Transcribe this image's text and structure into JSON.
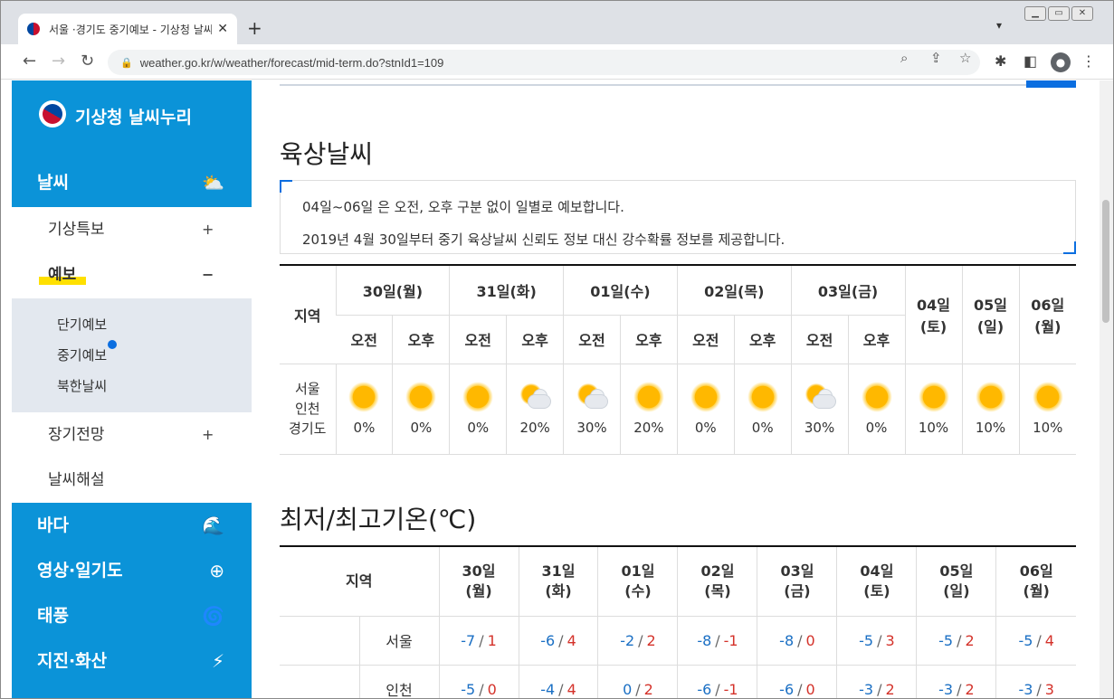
{
  "browser": {
    "tab_title": "서울 ·경기도 중기예보 - 기상청 날씨누리",
    "tab_close": "✕",
    "new_tab": "+",
    "url": "weather.go.kr/w/weather/forecast/mid-term.do?stnId1=109"
  },
  "sidebar": {
    "brand": "기상청 날씨누리",
    "categories": [
      {
        "label": "날씨",
        "icon": "weather-cloud-sun-icon"
      },
      {
        "label": "바다",
        "icon": "wave-icon"
      },
      {
        "label": "영상·일기도",
        "icon": "radar-target-icon"
      },
      {
        "label": "태풍",
        "icon": "typhoon-icon"
      },
      {
        "label": "지진·화산",
        "icon": "earthquake-icon"
      }
    ],
    "menu": [
      {
        "label": "기상특보",
        "toggle": "+"
      },
      {
        "label": "예보",
        "toggle": "−"
      },
      {
        "label": "장기전망",
        "toggle": "+"
      },
      {
        "label": "날씨해설"
      }
    ],
    "submenu": [
      "단기예보",
      "중기예보",
      "북한날씨"
    ]
  },
  "land": {
    "title": "육상날씨",
    "notice": [
      "04일~06일 은 오전, 오후 구분 없이 일별로 예보합니다.",
      "2019년 4월 30일부터 중기 육상날씨 신뢰도 정보 대신 강수확률 정보를 제공합니다."
    ],
    "region_header": "지역",
    "days_ampm": [
      "30일(월)",
      "31일(화)",
      "01일(수)",
      "02일(목)",
      "03일(금)"
    ],
    "days_daily": [
      [
        "04일",
        "(토)"
      ],
      [
        "05일",
        "(일)"
      ],
      [
        "06일",
        "(월)"
      ]
    ],
    "am": "오전",
    "pm": "오후",
    "region": [
      "서울",
      "인천",
      "경기도"
    ],
    "forecast": [
      {
        "icon": "sunny-icon",
        "prob": "0%"
      },
      {
        "icon": "sunny-icon",
        "prob": "0%"
      },
      {
        "icon": "sunny-icon",
        "prob": "0%"
      },
      {
        "icon": "partly-cloudy-icon",
        "prob": "20%"
      },
      {
        "icon": "partly-cloudy-icon",
        "prob": "30%"
      },
      {
        "icon": "sunny-icon",
        "prob": "20%"
      },
      {
        "icon": "sunny-icon",
        "prob": "0%"
      },
      {
        "icon": "sunny-icon",
        "prob": "0%"
      },
      {
        "icon": "partly-cloudy-icon",
        "prob": "30%"
      },
      {
        "icon": "sunny-icon",
        "prob": "0%"
      },
      {
        "icon": "sunny-icon",
        "prob": "10%"
      },
      {
        "icon": "sunny-icon",
        "prob": "10%"
      },
      {
        "icon": "sunny-icon",
        "prob": "10%"
      }
    ]
  },
  "temperature": {
    "title": "최저/최고기온(℃)",
    "region_header": "지역",
    "days": [
      [
        "30일",
        "(월)"
      ],
      [
        "31일",
        "(화)"
      ],
      [
        "01일",
        "(수)"
      ],
      [
        "02일",
        "(목)"
      ],
      [
        "03일",
        "(금)"
      ],
      [
        "04일",
        "(토)"
      ],
      [
        "05일",
        "(일)"
      ],
      [
        "06일",
        "(월)"
      ]
    ],
    "rows": [
      {
        "city": "서울",
        "values": [
          [
            "-7",
            "1"
          ],
          [
            "-6",
            "4"
          ],
          [
            "-2",
            "2"
          ],
          [
            "-8",
            "-1"
          ],
          [
            "-8",
            "0"
          ],
          [
            "-5",
            "3"
          ],
          [
            "-5",
            "2"
          ],
          [
            "-5",
            "4"
          ]
        ]
      },
      {
        "city": "인천",
        "values": [
          [
            "-5",
            "0"
          ],
          [
            "-4",
            "4"
          ],
          [
            "0",
            "2"
          ],
          [
            "-6",
            "-1"
          ],
          [
            "-6",
            "0"
          ],
          [
            "-3",
            "2"
          ],
          [
            "-3",
            "2"
          ],
          [
            "-3",
            "3"
          ]
        ]
      }
    ],
    "separator": "/",
    "min_color": "#1a6fc4",
    "max_color": "#d4322a"
  },
  "colors": {
    "accent": "#0b93d8",
    "highlight": "#ffe000",
    "link_blue": "#0b6ee0"
  }
}
